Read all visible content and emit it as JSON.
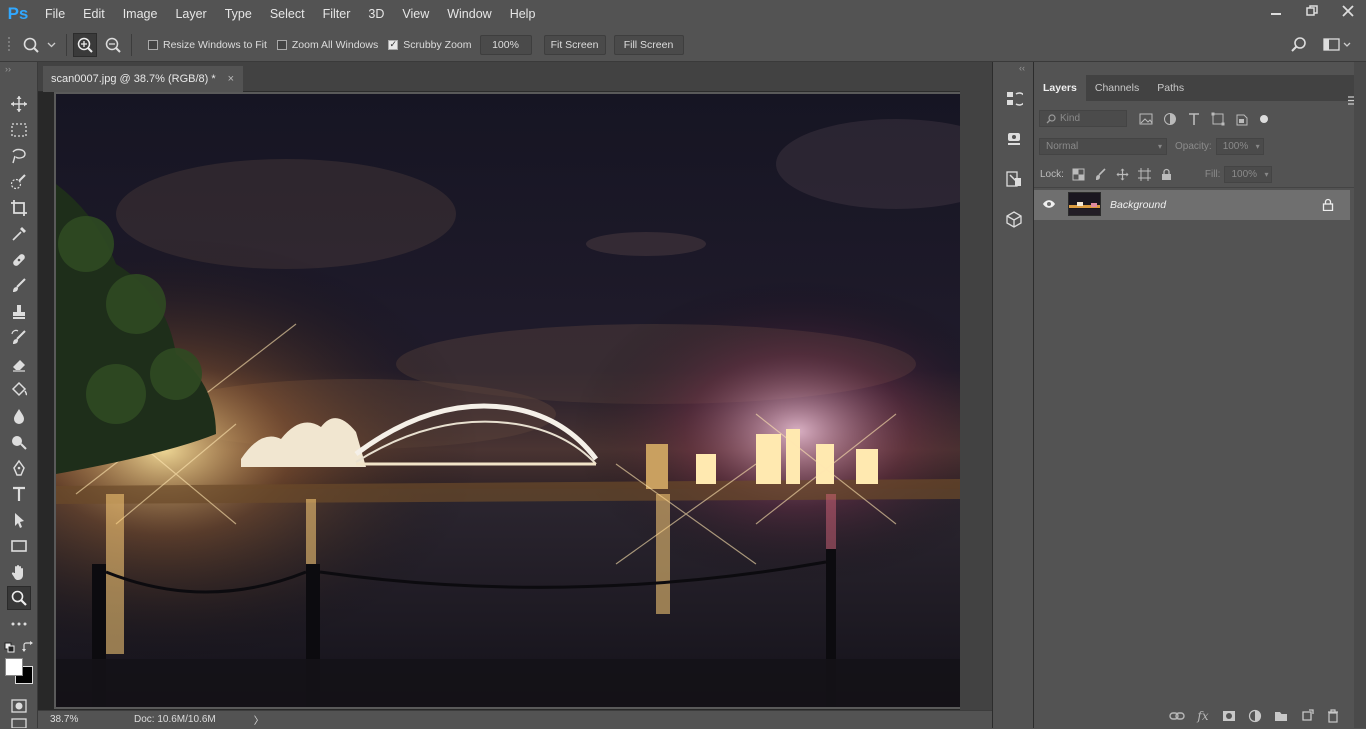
{
  "app": {
    "logo": "Ps"
  },
  "menu": [
    "File",
    "Edit",
    "Image",
    "Layer",
    "Type",
    "Select",
    "Filter",
    "3D",
    "View",
    "Window",
    "Help"
  ],
  "options": {
    "resize_windows_label": "Resize Windows to Fit",
    "resize_windows_checked": false,
    "zoom_all_label": "Zoom All Windows",
    "zoom_all_checked": false,
    "scrubby_zoom_label": "Scrubby Zoom",
    "scrubby_zoom_checked": true,
    "zoom_100_label": "100%",
    "fit_screen_label": "Fit Screen",
    "fill_screen_label": "Fill Screen"
  },
  "document": {
    "tab_title": "scan0007.jpg @ 38.7% (RGB/8) *",
    "close_glyph": "×"
  },
  "status": {
    "zoom": "38.7%",
    "doc_size": "Doc: 10.6M/10.6M",
    "arrow": "〉"
  },
  "layers_panel": {
    "tabs": [
      "Layers",
      "Channels",
      "Paths"
    ],
    "active_tab": "Layers",
    "filter_placeholder": "Kind",
    "blend_mode": "Normal",
    "opacity_label": "Opacity:",
    "opacity_value": "100%",
    "lock_label": "Lock:",
    "fill_label": "Fill:",
    "fill_value": "100%",
    "layers": [
      {
        "name": "Background",
        "visible": true,
        "locked": true
      }
    ],
    "footer_fx": "fx"
  },
  "colors": {
    "accent_logo": "#31a8ff",
    "ui_bg": "#535353",
    "panel_dark": "#424242",
    "selected_layer": "#6f6f6f"
  }
}
